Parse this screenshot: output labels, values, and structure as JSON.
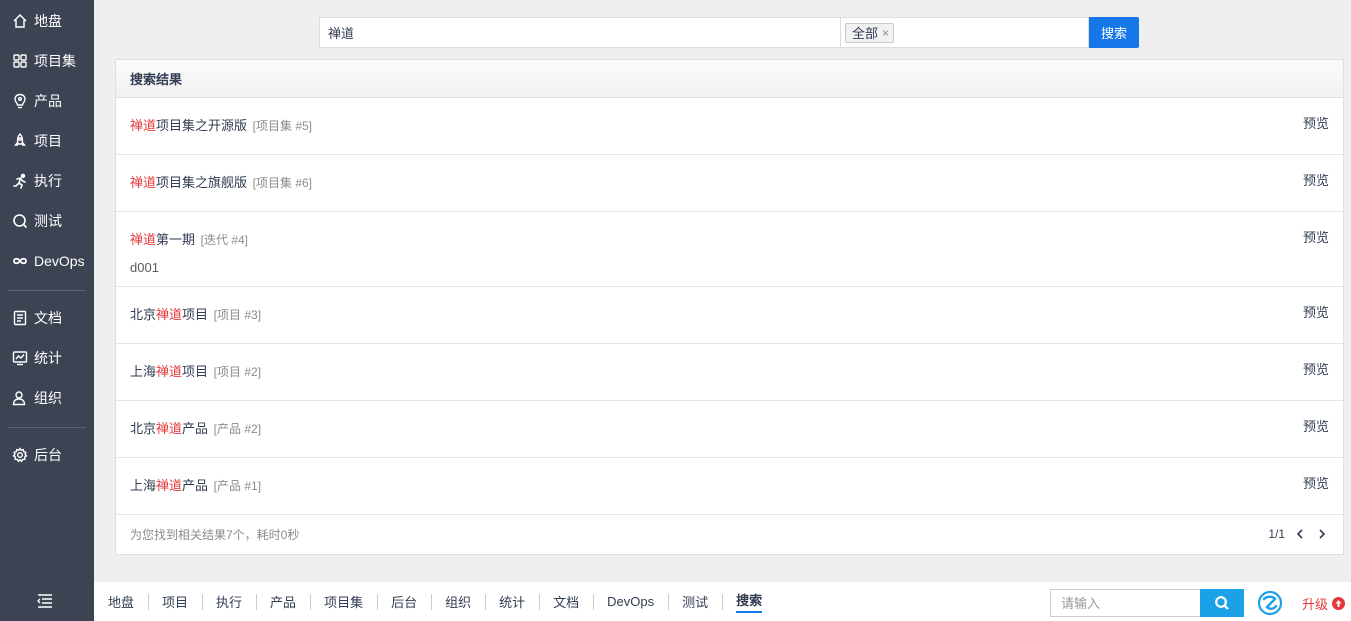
{
  "sidebar": {
    "items": [
      {
        "label": "地盘",
        "icon": "home-icon"
      },
      {
        "label": "项目集",
        "icon": "grid-icon"
      },
      {
        "label": "产品",
        "icon": "lightbulb-icon"
      },
      {
        "label": "项目",
        "icon": "rocket-icon"
      },
      {
        "label": "执行",
        "icon": "runner-icon"
      },
      {
        "label": "测试",
        "icon": "magnifier-icon"
      },
      {
        "label": "DevOps",
        "icon": "infinity-icon"
      },
      {
        "label": "文档",
        "icon": "document-icon"
      },
      {
        "label": "统计",
        "icon": "chart-icon"
      },
      {
        "label": "组织",
        "icon": "user-icon"
      },
      {
        "label": "后台",
        "icon": "gear-icon"
      }
    ]
  },
  "search": {
    "query": "禅道",
    "type_chip": "全部",
    "chip_close": "×",
    "button": "搜索"
  },
  "results": {
    "header": "搜索结果",
    "items": [
      {
        "pre": "",
        "hl": "禅道",
        "post": "项目集之开源版",
        "meta": "[项目集 #5]",
        "desc": "",
        "preview": "预览"
      },
      {
        "pre": "",
        "hl": "禅道",
        "post": "项目集之旗舰版",
        "meta": "[项目集 #6]",
        "desc": "",
        "preview": "预览"
      },
      {
        "pre": "",
        "hl": "禅道",
        "post": "第一期",
        "meta": "[迭代 #4]",
        "desc": "d001",
        "preview": "预览"
      },
      {
        "pre": "北京",
        "hl": "禅道",
        "post": "项目",
        "meta": "[项目 #3]",
        "desc": "",
        "preview": "预览"
      },
      {
        "pre": "上海",
        "hl": "禅道",
        "post": "项目",
        "meta": "[项目 #2]",
        "desc": "",
        "preview": "预览"
      },
      {
        "pre": "北京",
        "hl": "禅道",
        "post": "产品",
        "meta": "[产品 #2]",
        "desc": "",
        "preview": "预览"
      },
      {
        "pre": "上海",
        "hl": "禅道",
        "post": "产品",
        "meta": "[产品 #1]",
        "desc": "",
        "preview": "预览"
      }
    ],
    "summary": "为您找到相关结果7个，耗时0秒",
    "pager": "1/1"
  },
  "bottombar": {
    "tabs": [
      "地盘",
      "项目",
      "执行",
      "产品",
      "项目集",
      "后台",
      "组织",
      "统计",
      "文档",
      "DevOps",
      "测试",
      "搜索"
    ],
    "active_tab": "搜索",
    "quick_search_placeholder": "请输入",
    "upgrade": "升级"
  },
  "colors": {
    "sidebar_bg": "#3c4353",
    "accent": "#1677e8",
    "highlight": "#e4393c",
    "quick_search": "#1aa1e8"
  }
}
